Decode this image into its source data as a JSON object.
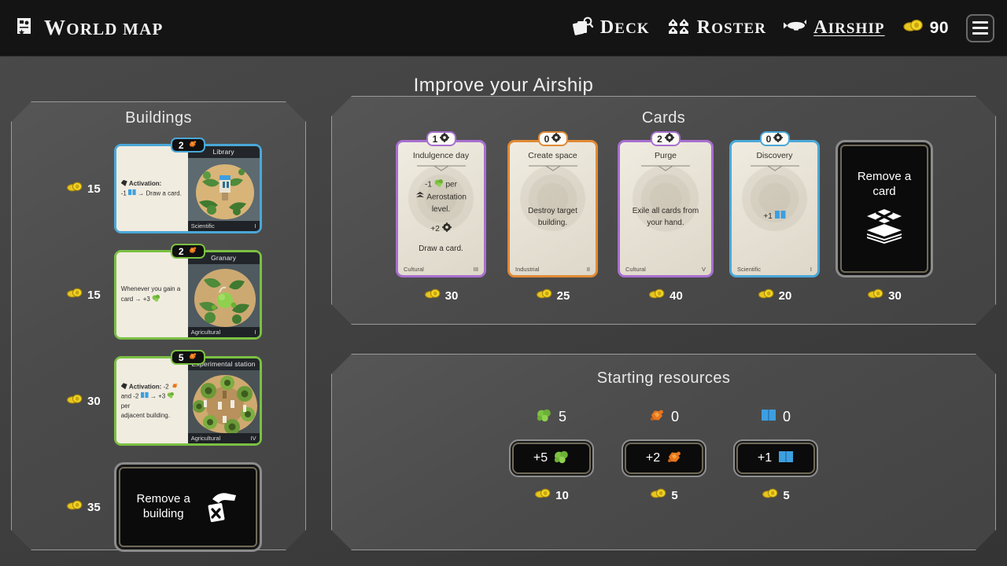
{
  "topbar": {
    "world_map": {
      "label": "World map",
      "icon": "map-scroll-icon"
    },
    "nav": [
      {
        "label": "Deck",
        "icon": "deck-cards-icon",
        "active": false
      },
      {
        "label": "Roster",
        "icon": "roster-people-icon",
        "active": false
      },
      {
        "label": "Airship",
        "icon": "airship-icon",
        "active": true
      }
    ],
    "gold": {
      "amount": "90",
      "icon": "gold-coins-icon"
    },
    "menu": {
      "icon": "hamburger-menu-icon"
    }
  },
  "page": {
    "title": "Improve your Airship"
  },
  "buildings": {
    "title": "Buildings",
    "items": [
      {
        "price": "15",
        "cost_value": "2",
        "cost_icon": "ore-icon",
        "name": "Library",
        "text": "Activation: -1 ❙ → Draw a card.",
        "effect_pre": "Activation:",
        "effect_body": "-1",
        "effect_tail": "→  Draw a card.",
        "category": "Scientific",
        "tier": "I",
        "color": "#4aa8d8",
        "theme": "blue"
      },
      {
        "price": "15",
        "cost_value": "2",
        "cost_icon": "ore-icon",
        "name": "Granary",
        "text": "Whenever you gain a card → +3",
        "effect_pre": "",
        "effect_body": "Whenever you gain a card → +3",
        "effect_tail": "",
        "category": "Agricultural",
        "tier": "I",
        "color": "#7bc043",
        "theme": "green"
      },
      {
        "price": "30",
        "cost_value": "5",
        "cost_icon": "ore-icon",
        "name": "Experimental station",
        "text": "Activation: -2 ore and -2 knowledge → +3 food per adjacent building.",
        "effect_pre": "Activation:",
        "effect_body": "-2",
        "effect_tail": "and -2",
        "category": "Agricultural",
        "tier": "IV",
        "color": "#7bc043",
        "theme": "green"
      }
    ],
    "remove": {
      "price": "35",
      "label_line1": "Remove a",
      "label_line2": "building",
      "icon": "hand-discard-card-icon"
    }
  },
  "cards": {
    "title": "Cards",
    "items": [
      {
        "cost": "1",
        "cost_icon": "aerostation-icon",
        "title": "Indulgence day",
        "body_lines": [
          "-1 ♣ per",
          "◆ Aerostation",
          "level.",
          "",
          "+2 ⚙",
          "",
          "Draw a card."
        ],
        "category": "Cultural",
        "tier": "III",
        "price": "30",
        "theme": "purple",
        "color": "#a86fd0"
      },
      {
        "cost": "0",
        "cost_icon": "aerostation-icon",
        "title": "Create space",
        "body_lines": [
          "Destroy target",
          "building."
        ],
        "category": "Industrial",
        "tier": "II",
        "price": "25",
        "theme": "orange",
        "color": "#e08a36"
      },
      {
        "cost": "2",
        "cost_icon": "aerostation-icon",
        "title": "Purge",
        "body_lines": [
          "Exile all cards from",
          "your hand."
        ],
        "category": "Cultural",
        "tier": "V",
        "price": "40",
        "theme": "purple",
        "color": "#a86fd0"
      },
      {
        "cost": "0",
        "cost_icon": "aerostation-icon",
        "title": "Discovery",
        "body_lines": [
          "+1 ❙"
        ],
        "category": "Scientific",
        "tier": "I",
        "price": "20",
        "theme": "blue",
        "color": "#4aa8d8"
      }
    ],
    "remove": {
      "price": "30",
      "label_line1": "Remove a",
      "label_line2": "card",
      "icon": "remove-card-stack-icon"
    }
  },
  "resources": {
    "title": "Starting resources",
    "items": [
      {
        "icon": "food-icon",
        "have": "5",
        "button_label": "+5",
        "price": "10"
      },
      {
        "icon": "ore-icon",
        "have": "0",
        "button_label": "+2",
        "price": "5"
      },
      {
        "icon": "knowledge-icon",
        "have": "0",
        "button_label": "+1",
        "price": "5"
      }
    ]
  },
  "colors": {
    "gold": "#e8c51f",
    "food_green": "#7dc242",
    "ore_orange": "#e8761f",
    "knowledge_blue": "#3d9fe0",
    "purple": "#a86fd0",
    "orange": "#e08a36",
    "blue": "#4aa8d8",
    "green": "#7bc043"
  }
}
